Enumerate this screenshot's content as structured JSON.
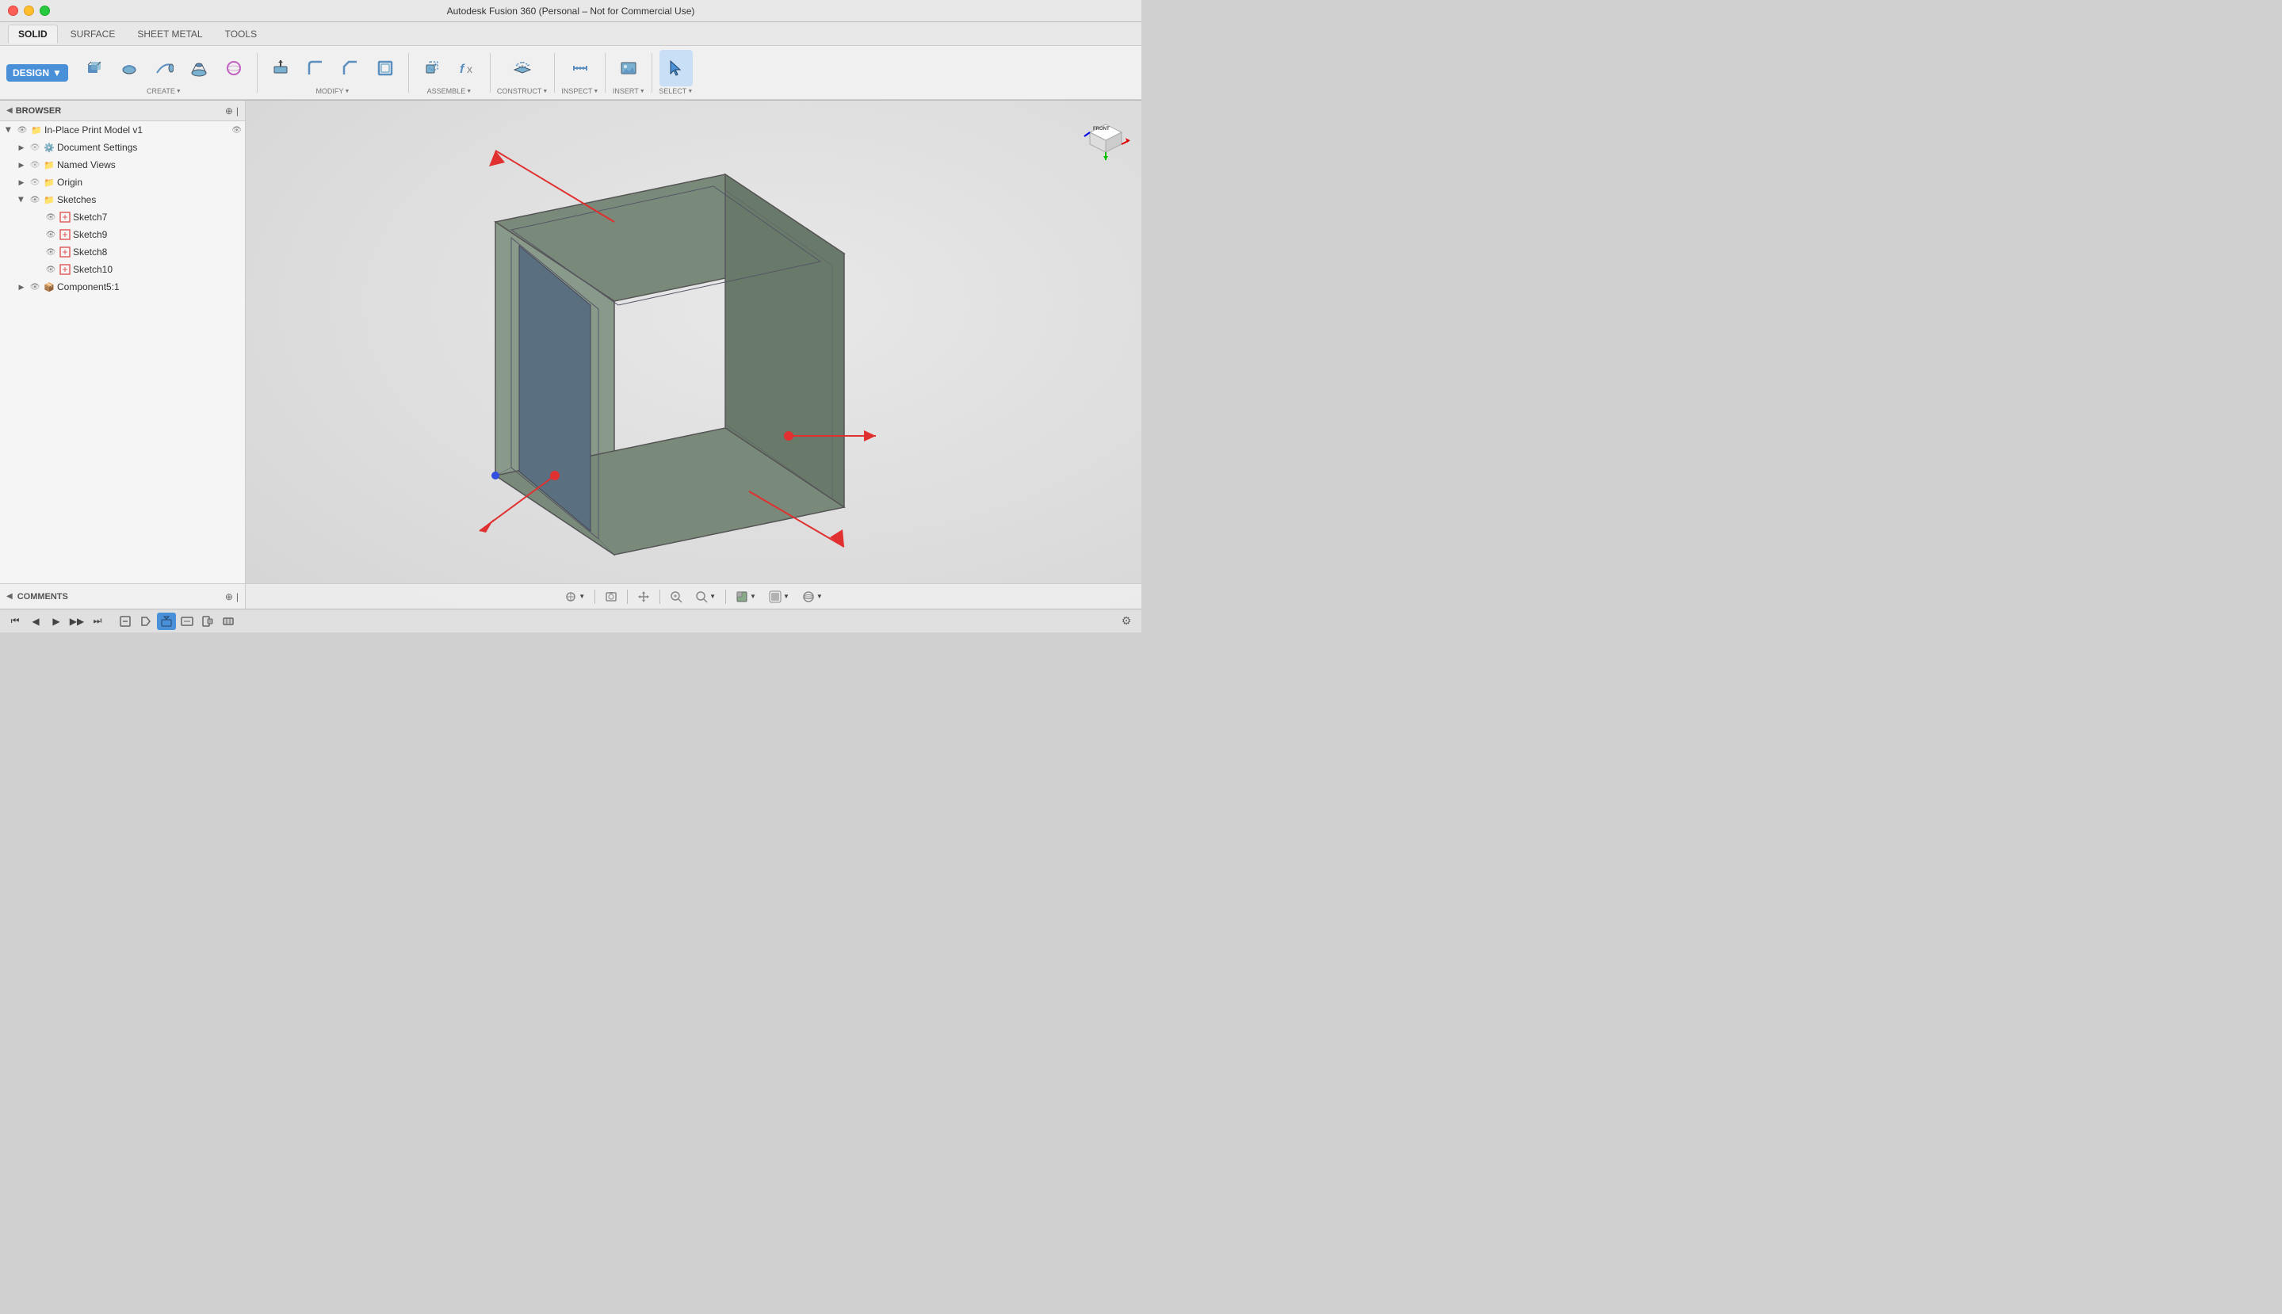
{
  "app": {
    "title": "Autodesk Fusion 360 (Personal – Not for Commercial Use)",
    "document_title": "In-Place Print Model v1*"
  },
  "tabs": {
    "solid": "SOLID",
    "surface": "SURFACE",
    "sheet_metal": "SHEET METAL",
    "tools": "TOOLS"
  },
  "toolbar": {
    "design_label": "DESIGN",
    "groups": [
      {
        "label": "CREATE",
        "has_arrow": true
      },
      {
        "label": "MODIFY",
        "has_arrow": true
      },
      {
        "label": "ASSEMBLE",
        "has_arrow": true
      },
      {
        "label": "CONSTRUCT",
        "has_arrow": true
      },
      {
        "label": "INSPECT",
        "has_arrow": true
      },
      {
        "label": "INSERT",
        "has_arrow": true
      },
      {
        "label": "SELECT",
        "has_arrow": true
      }
    ]
  },
  "browser": {
    "title": "BROWSER",
    "root_item": "In-Place Print Model v1",
    "items": [
      {
        "label": "Document Settings",
        "type": "settings",
        "level": 1,
        "expanded": false
      },
      {
        "label": "Named Views",
        "type": "folder",
        "level": 1,
        "expanded": false
      },
      {
        "label": "Origin",
        "type": "folder",
        "level": 1,
        "expanded": false
      },
      {
        "label": "Sketches",
        "type": "folder",
        "level": 1,
        "expanded": true
      },
      {
        "label": "Sketch7",
        "type": "sketch",
        "level": 2
      },
      {
        "label": "Sketch9",
        "type": "sketch",
        "level": 2
      },
      {
        "label": "Sketch8",
        "type": "sketch",
        "level": 2
      },
      {
        "label": "Sketch10",
        "type": "sketch",
        "level": 2
      },
      {
        "label": "Component5:1",
        "type": "component",
        "level": 1,
        "expanded": false
      }
    ]
  },
  "comments": {
    "label": "COMMENTS"
  },
  "timeline": {
    "buttons": [
      "⏮",
      "◀",
      "▶",
      "▶▶",
      "⏭"
    ]
  },
  "gizmo": {
    "front_label": "FRONT"
  },
  "viewport_toolbar": {
    "grid_snap": "grid-snap",
    "capture_image": "capture",
    "pan": "pan",
    "zoom_fit": "zoom-fit",
    "zoom": "zoom",
    "display": "display",
    "visual_style": "visual-style",
    "environment": "environment"
  }
}
